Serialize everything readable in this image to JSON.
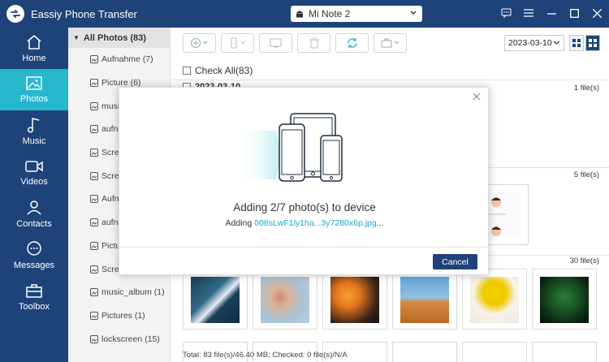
{
  "app": {
    "title": "Eassiy Phone Transfer"
  },
  "device": {
    "name": "Mi Note 2"
  },
  "nav": [
    {
      "label": "Home",
      "icon": "home-icon",
      "active": false
    },
    {
      "label": "Photos",
      "icon": "photo-icon",
      "active": true
    },
    {
      "label": "Music",
      "icon": "music-icon",
      "active": false
    },
    {
      "label": "Videos",
      "icon": "video-icon",
      "active": false
    },
    {
      "label": "Contacts",
      "icon": "contacts-icon",
      "active": false
    },
    {
      "label": "Messages",
      "icon": "message-icon",
      "active": false
    },
    {
      "label": "Toolbox",
      "icon": "toolbox-icon",
      "active": false
    }
  ],
  "albums": {
    "header": "All Photos (83)",
    "items": [
      "Aufnahme (7)",
      "Picture (6)",
      "music",
      "aufna",
      "Scree",
      "Scree",
      "Aufna",
      "aufna",
      "Pictur",
      "Scree",
      "music_album (1)",
      "Pictures (1)",
      "lockscreen (15)"
    ]
  },
  "toolbar": {
    "date_value": "2023-03-10"
  },
  "main": {
    "check_all": "Check All(83)",
    "groups": [
      {
        "date": "2023-03-10",
        "count": "1 file(s)"
      },
      {
        "date": "",
        "count": "5 file(s)"
      },
      {
        "date": "",
        "count": "30 file(s)"
      }
    ],
    "status": "Total: 83 file(s)/46.40 MB; Checked: 0 file(s)/N/A"
  },
  "dialog": {
    "title": "Adding 2/7 photo(s) to device",
    "adding_label": "Adding",
    "filename": "008sLwF1ly1ha...3y7280x6p.jpg",
    "ellipsis": "...",
    "cancel": "Cancel"
  },
  "colors": {
    "nav_bg": "#1e4379",
    "accent": "#27b8ce",
    "link": "#1aa9c7"
  }
}
